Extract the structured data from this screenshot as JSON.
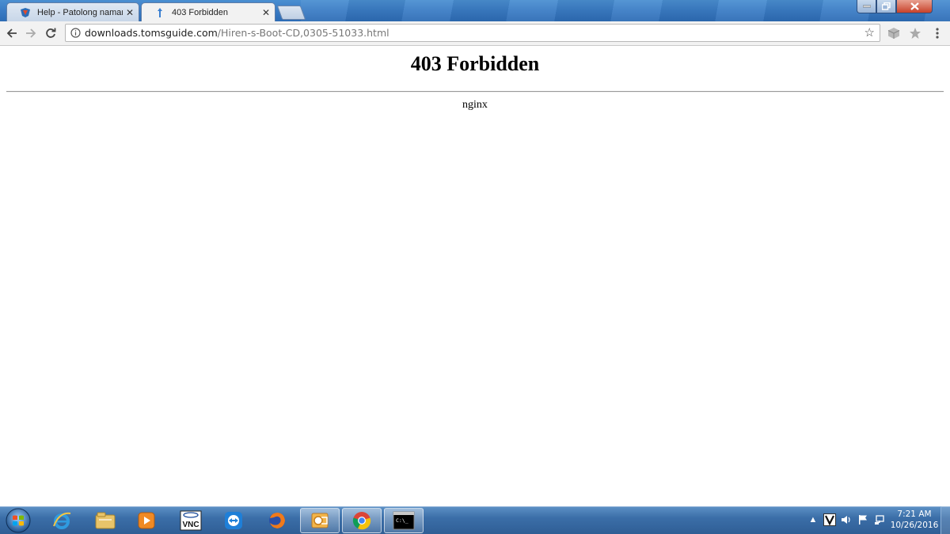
{
  "browser": {
    "tabs": [
      {
        "title": "Help - Patolong naman s",
        "active": false,
        "favicon": "toms-guide-icon"
      },
      {
        "title": "403 Forbidden",
        "active": true,
        "favicon": "loading-arrow-icon"
      }
    ],
    "address": {
      "host": "downloads.tomsguide.com",
      "path": "/Hiren-s-Boot-CD,0305-51033.html"
    }
  },
  "page": {
    "heading": "403 Forbidden",
    "server": "nginx"
  },
  "taskbar": {
    "apps": [
      "internet-explorer",
      "file-explorer",
      "media-player",
      "vnc",
      "teamviewer",
      "firefox",
      "outlook",
      "chrome",
      "command-prompt"
    ],
    "vnc_label": "VNC",
    "cmd_label": "C:\\_",
    "clock": {
      "time": "7:21 AM",
      "date": "10/26/2016"
    }
  },
  "colors": {
    "taskbar": "#3b6ea8",
    "titlebar": "#3b7dc6",
    "toolbar": "#f2f2f2"
  }
}
